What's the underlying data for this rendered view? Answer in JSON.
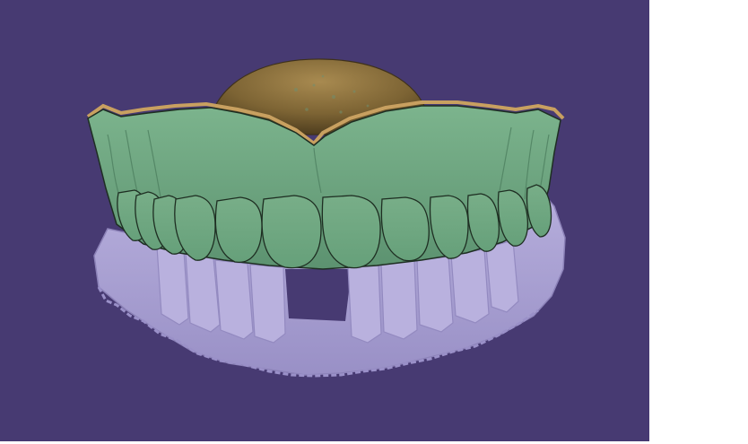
{
  "viewport": {
    "background_color": "#473a72",
    "panel_color": "#ffffff"
  },
  "model": {
    "upper_denture_color": "#6ea680",
    "upper_denture_outline": "#1e2e22",
    "palate_color": "#8a6f3a",
    "gingival_margin_color": "#c8a060",
    "lower_scan_color": "#a89fd0",
    "lower_scan_shadow": "#8c82b8",
    "icon": "dental-model-icon"
  }
}
